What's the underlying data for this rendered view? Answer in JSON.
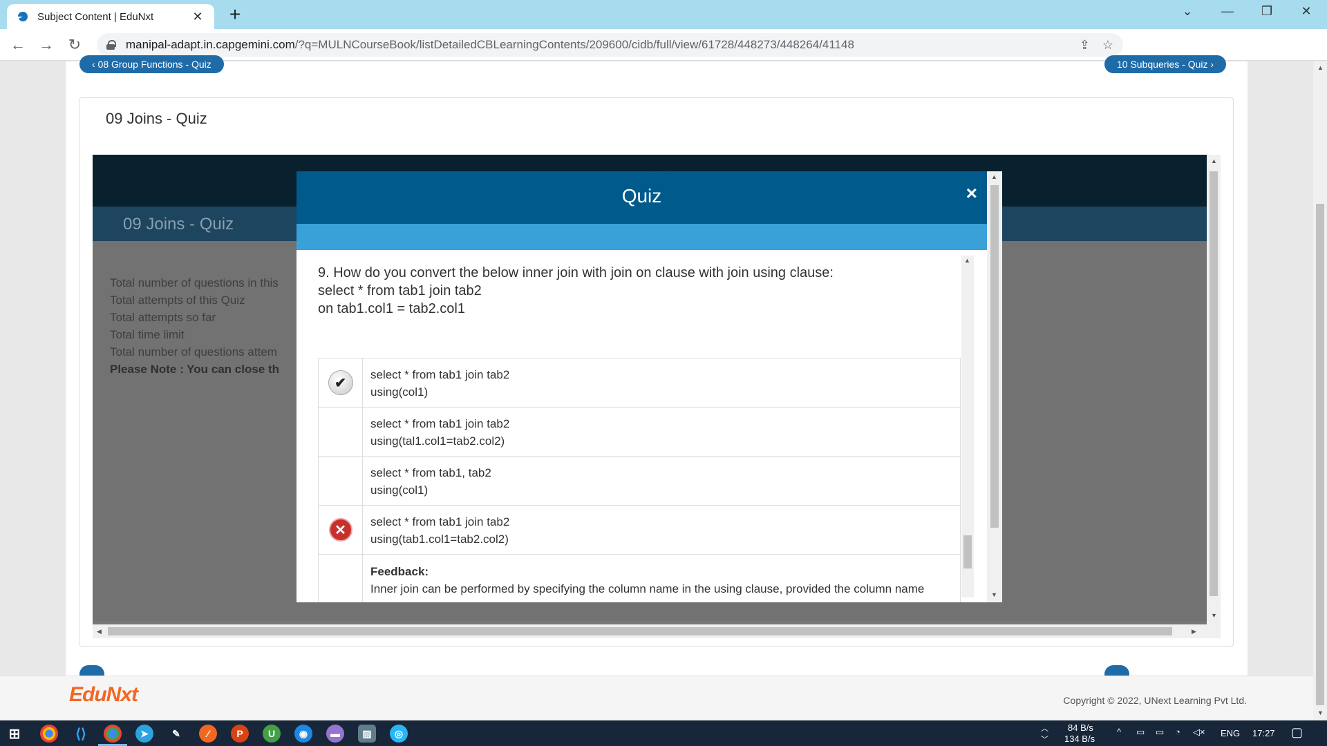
{
  "browser": {
    "tab_title": "Subject Content | EduNxt",
    "url_host": "manipal-adapt.in.capgemini.com",
    "url_path": "/?q=MULNCourseBook/listDetailedCBLearningContents/209600/cidb/full/view/61728/448273/448264/41148"
  },
  "page": {
    "prev_link": "‹ 08 Group Functions - Quiz",
    "next_link": "10 Subqueries - Quiz ›",
    "card_title": "09 Joins - Quiz",
    "frame_header": "Quiz",
    "frame_subheader": "09 Joins - Quiz",
    "info_lines": [
      "Total number of questions in this",
      "Total attempts of this Quiz",
      "Total attempts so far",
      "Total time limit",
      "Total number of questions attem"
    ],
    "note": "Please Note : You can close th"
  },
  "modal": {
    "title": "Quiz",
    "close": "×",
    "question_line1": "9. How do you convert the below inner join with join on clause with join using clause:",
    "question_line2": "select * from tab1 join tab2",
    "question_line3": "on tab1.col1 = tab2.col1",
    "options": [
      {
        "line1": "select * from tab1 join tab2",
        "line2": "using(col1)",
        "mark": "correct"
      },
      {
        "line1": "select * from tab1 join tab2",
        "line2": "using(tal1.col1=tab2.col2)",
        "mark": "none"
      },
      {
        "line1": "select * from tab1, tab2",
        "line2": "using(col1)",
        "mark": "none"
      },
      {
        "line1": "select * from tab1 join tab2",
        "line2": "using(tab1.col1=tab2.col2)",
        "mark": "wrong"
      }
    ],
    "feedback_label": "Feedback:",
    "feedback_text": "Inner join can be performed by specifying the column name in the using clause, provided the column name"
  },
  "footer": {
    "logo_edu": "Edu",
    "logo_nxt": "Nxt",
    "copyright": "Copyright © 2022, UNext Learning Pvt Ltd."
  },
  "taskbar": {
    "net_up": "84 B/s",
    "net_down": "134 B/s",
    "lang": "ENG",
    "time": "17:27"
  },
  "colors": {
    "modal_header": "#005a8c",
    "modal_band": "#3aa0d8",
    "nav_pill": "#1f6ba8",
    "brand_orange": "#f26722"
  }
}
